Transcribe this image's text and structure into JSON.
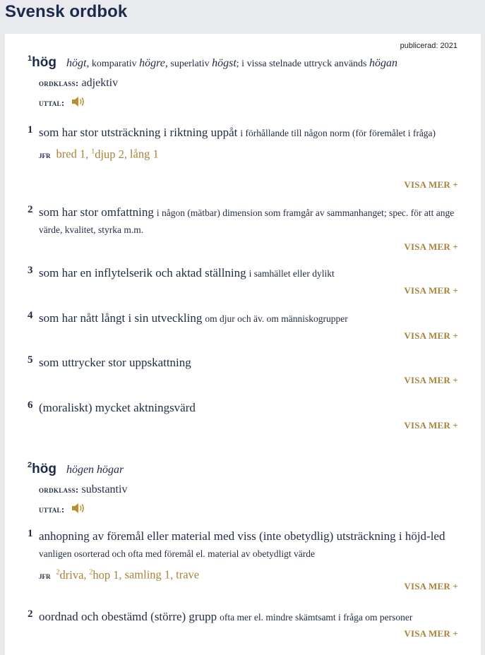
{
  "app": {
    "title": "Svensk ordbok"
  },
  "published": "publicerad: 2021",
  "labels": {
    "ordklass": "ordklass:",
    "uttal": "uttal:",
    "jfr": "jfr",
    "visa_mer": "VISA MER +"
  },
  "colors": {
    "accent": "#a7833a",
    "text": "#1f2a44",
    "page_bg": "#e9eaee",
    "panel_bg": "#ffffff"
  },
  "entries": [
    {
      "sup": "1",
      "headword": "hög",
      "infl": {
        "w1": "högt,",
        "t1": " komparativ ",
        "w2": "högre,",
        "t2": " superlativ ",
        "w3": "högst",
        "t3": "; i vissa stelnade uttryck används ",
        "w4": "högan"
      },
      "ordklass": "adjektiv",
      "audio_icon": "speaker-icon",
      "senses": [
        {
          "num": "1",
          "main": "som har stor utsträckning i riktning uppåt",
          "sub": "i förhållande till någon norm (för föremålet i fråga)",
          "jfr": [
            {
              "sup": "",
              "text": "bred 1"
            },
            {
              "sup": "1",
              "text": "djup 2"
            },
            {
              "sup": "",
              "text": "lång 1"
            }
          ]
        },
        {
          "num": "2",
          "main": "som har stor omfattning",
          "sub": "i någon (mätbar) dimension som framgår av sammanhanget; spec. för att ange värde, kvalitet, styrka m.m."
        },
        {
          "num": "3",
          "main": "som har en inflytelserik och aktad ställning",
          "sub": "i samhället eller dylikt"
        },
        {
          "num": "4",
          "main": "som har nått långt i sin utveckling",
          "sub": "om djur och äv. om människogrupper"
        },
        {
          "num": "5",
          "main": "som uttrycker stor uppskattning",
          "sub": ""
        },
        {
          "num": "6",
          "main": "(moraliskt) mycket aktningsvärd",
          "sub": ""
        }
      ]
    },
    {
      "sup": "2",
      "headword": "hög",
      "infl": {
        "w1": "högen högar"
      },
      "ordklass": "substantiv",
      "audio_icon": "speaker-icon",
      "senses": [
        {
          "num": "1",
          "main": "anhopning av föremål eller material med viss (inte obetydlig) utsträckning i höjd-led",
          "sub": "vanligen osorterad och ofta med föremål el. material av obetydligt värde",
          "jfr": [
            {
              "sup": "2",
              "text": "driva"
            },
            {
              "sup": "2",
              "text": "hop 1"
            },
            {
              "sup": "",
              "text": "samling 1"
            },
            {
              "sup": "",
              "text": "trave"
            }
          ]
        },
        {
          "num": "2",
          "main": "oordnad och obestämd (större) grupp",
          "sub": "ofta mer el. mindre skämtsamt i fråga om personer"
        }
      ]
    }
  ]
}
